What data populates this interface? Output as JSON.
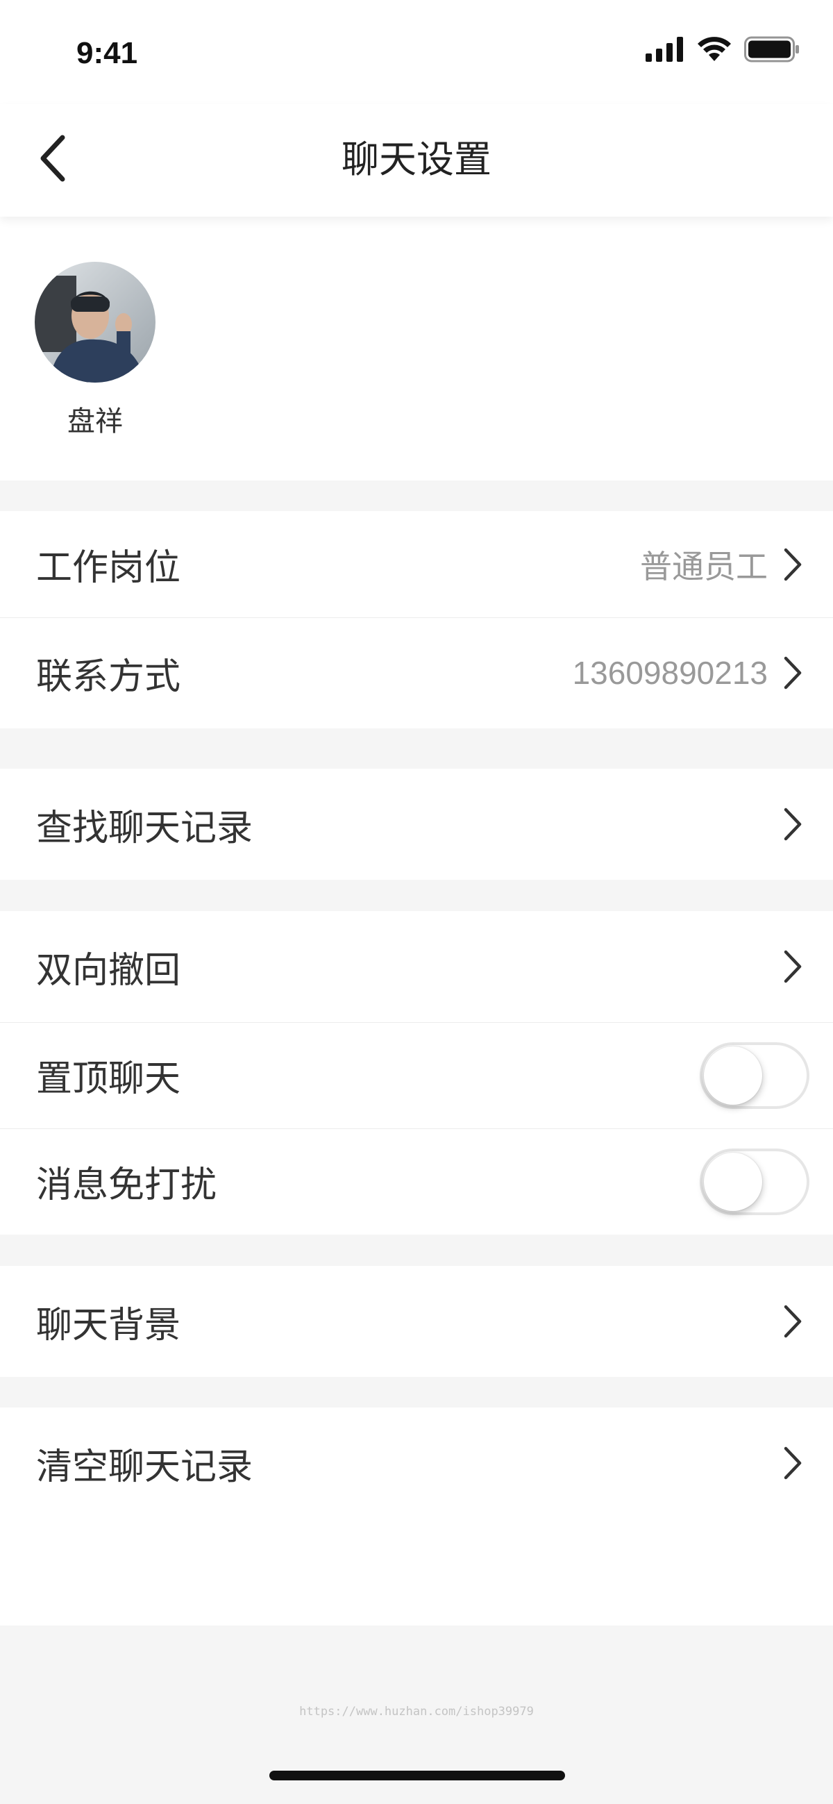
{
  "status_bar": {
    "time": "9:41",
    "icons": [
      "cellular-signal-icon",
      "wifi-icon",
      "battery-icon"
    ]
  },
  "nav": {
    "back_icon": "chevron-left-icon",
    "title": "聊天设置"
  },
  "profile": {
    "name": "盘祥"
  },
  "rows": {
    "position": {
      "label": "工作岗位",
      "value": "普通员工"
    },
    "contact": {
      "label": "联系方式",
      "value": "13609890213"
    },
    "search_history": {
      "label": "查找聊天记录"
    },
    "recall": {
      "label": "双向撤回"
    },
    "pin_chat": {
      "label": "置顶聊天",
      "on": false
    },
    "do_not_disturb": {
      "label": "消息免打扰",
      "on": false
    },
    "chat_background": {
      "label": "聊天背景"
    },
    "clear_history": {
      "label": "清空聊天记录"
    }
  },
  "footer": {
    "watermark": "https://www.huzhan.com/ishop39979"
  },
  "colors": {
    "background": "#f5f5f5",
    "surface": "#ffffff",
    "text_primary": "#333333",
    "text_secondary": "#999999",
    "divider": "#ececec",
    "toggle_border": "#e6e6e6"
  }
}
